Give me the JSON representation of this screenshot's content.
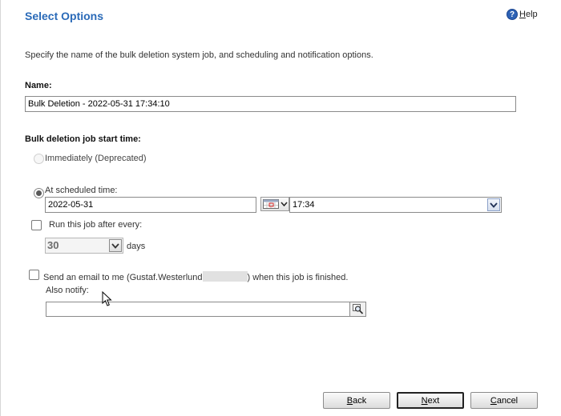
{
  "header": {
    "title": "Select Options",
    "help_icon": "help-question-icon",
    "help_accel": "H",
    "help_rest": "elp"
  },
  "description": "Specify the name of the bulk deletion system job, and scheduling and notification options.",
  "name_section": {
    "label": "Name:",
    "value": "Bulk Deletion - 2022-05-31 17:34:10"
  },
  "start_time": {
    "label": "Bulk deletion job start time:",
    "immediately_label": "Immediately (Deprecated)",
    "immediately_selected": false,
    "immediately_disabled": true,
    "scheduled_label": "At scheduled time:",
    "scheduled_selected": true,
    "date_value": "2022-05-31",
    "calendar_icon": "calendar-icon",
    "time_value": "17:34"
  },
  "recurrence": {
    "checkbox_label": "Run this job after every:",
    "checked": false,
    "interval_value": "30",
    "interval_unit": "days"
  },
  "notification": {
    "email_label_prefix": "Send an email to me (Gustaf.Westerlund",
    "email_label_suffix": ") when this job is finished.",
    "checked": false,
    "also_notify_label": "Also notify:",
    "also_notify_value": "",
    "lookup_icon": "lookup-search-icon"
  },
  "footer": {
    "back": {
      "accel": "B",
      "rest": "ack"
    },
    "next": {
      "accel": "N",
      "rest": "ext"
    },
    "cancel": {
      "accel": "C",
      "rest": "ancel"
    }
  },
  "colors": {
    "title": "#2a6ab8",
    "help_icon": "#2d62b5",
    "redaction": "#e1e1e1"
  }
}
